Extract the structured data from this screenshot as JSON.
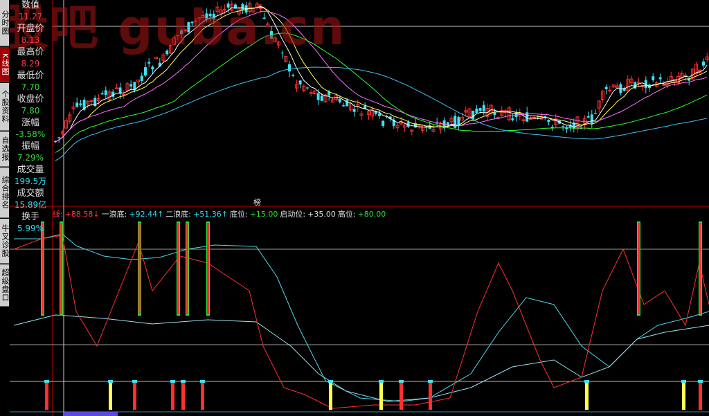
{
  "sidebar_tabs": [
    {
      "label": "分时图",
      "active": false
    },
    {
      "label": "K线图",
      "active": true
    },
    {
      "label": "个股资料",
      "active": false
    },
    {
      "label": "自选报",
      "active": false
    },
    {
      "label": "综合排名",
      "active": false
    },
    {
      "label": "牛叉诊股",
      "active": false
    },
    {
      "label": "超级盘口",
      "active": false
    }
  ],
  "info_panel": [
    {
      "label": "数值",
      "value": "11.27",
      "color": "#ff3b3b"
    },
    {
      "label": "开盘价",
      "value": "8.13",
      "color": "#ff3b3b"
    },
    {
      "label": "最高价",
      "value": "8.29",
      "color": "#ff3b3b"
    },
    {
      "label": "最低价",
      "value": "7.70",
      "color": "#33dd33"
    },
    {
      "label": "收盘价",
      "value": "7.80",
      "color": "#33dd33"
    },
    {
      "label": "涨幅",
      "value": "-3.58%",
      "color": "#33dd33"
    },
    {
      "label": "振幅",
      "value": "7.29%",
      "color": "#33dd33"
    },
    {
      "label": "成交量",
      "value": "199.5万",
      "color": "#33ddee"
    },
    {
      "label": "成交额",
      "value": "15.89亿",
      "color": "#33ddee"
    },
    {
      "label": "换手",
      "value": "5.99%",
      "color": "#33ddee"
    }
  ],
  "watermark": "股吧 guba.cn",
  "marker_label": "榜",
  "indicator": {
    "items": [
      {
        "text": "线:",
        "color": "#ff3b3b"
      },
      {
        "text": "+88.58↓",
        "color": "#ff3b3b"
      },
      {
        "text": "一浪底:",
        "color": "#e0e0e0"
      },
      {
        "text": "+92.44↑",
        "color": "#33ddee"
      },
      {
        "text": "二浪底:",
        "color": "#e0e0e0"
      },
      {
        "text": "+51.36↑",
        "color": "#33ddee"
      },
      {
        "text": "底位:",
        "color": "#e0e0e0"
      },
      {
        "text": "+15.00",
        "color": "#33dd33"
      },
      {
        "text": "启动位:",
        "color": "#e0e0e0"
      },
      {
        "text": "+35.00",
        "color": "#e0e0e0"
      },
      {
        "text": "高位:",
        "color": "#e0e0e0"
      },
      {
        "text": "+80.00",
        "color": "#33dd33"
      }
    ]
  },
  "colors": {
    "up": "#ff3030",
    "down": "#40e0f0",
    "ma5": "#ffffff",
    "ma10": "#ffff60",
    "ma20": "#ff70ff",
    "ma30": "#30ff30",
    "ma60": "#40c0f0",
    "divider": "#c00000"
  }
}
